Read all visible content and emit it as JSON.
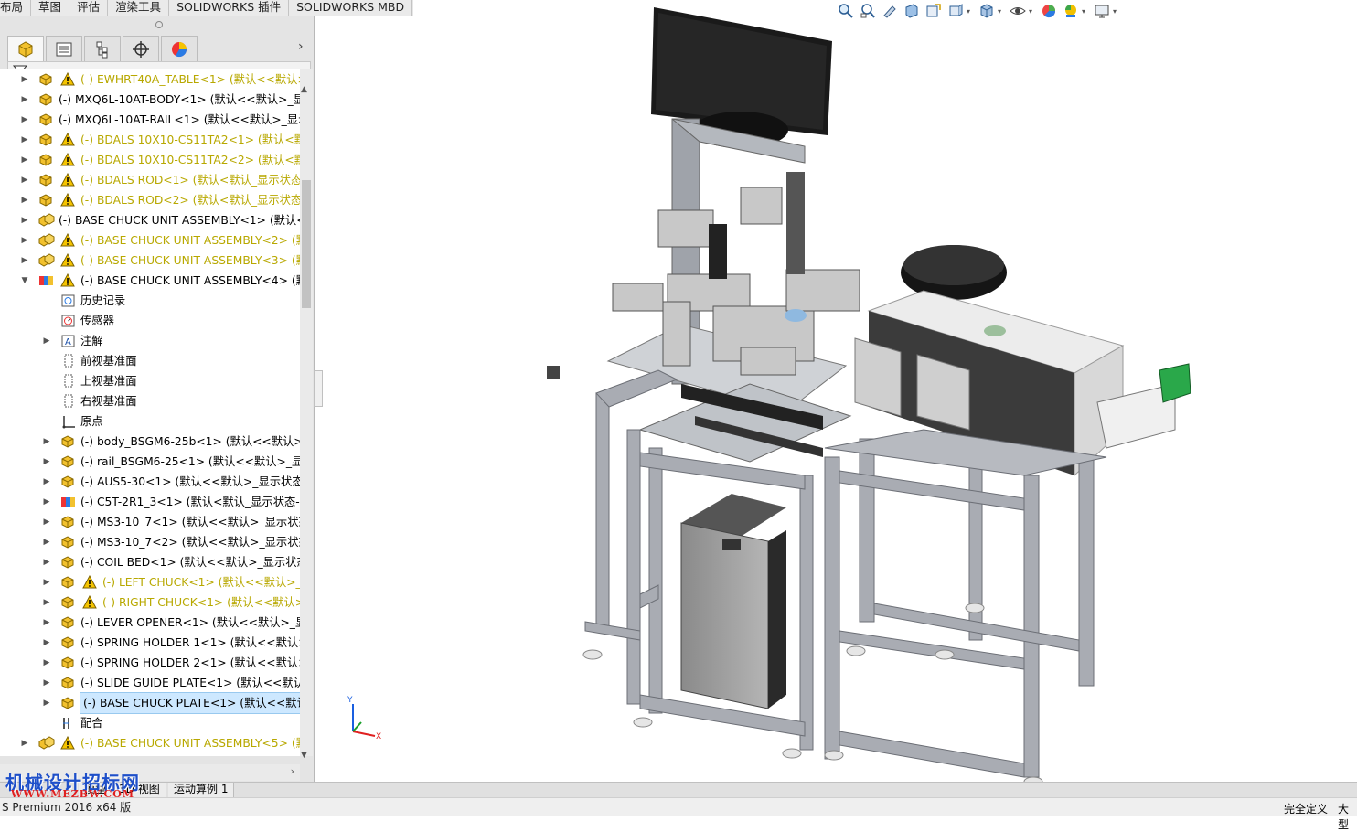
{
  "command_tabs": [
    "布局",
    "草图",
    "评估",
    "渲染工具",
    "SOLIDWORKS 插件",
    "SOLIDWORKS MBD"
  ],
  "panel_tabs": [
    "feature-manager",
    "property-manager",
    "configuration-manager",
    "dimxpert-manager",
    "display-manager"
  ],
  "tree": [
    {
      "label": "(-) EWHRT40A_TABLE<1> (默认<<默认>_",
      "warn": true,
      "yellow": true,
      "level": 0,
      "expand": "closed"
    },
    {
      "label": "(-) MXQ6L-10AT-BODY<1> (默认<<默认>_显示",
      "warn": false,
      "yellow": false,
      "level": 0,
      "expand": "closed"
    },
    {
      "label": "(-) MXQ6L-10AT-RAIL<1> (默认<<默认>_显示",
      "warn": false,
      "yellow": false,
      "level": 0,
      "expand": "closed"
    },
    {
      "label": "(-) BDALS 10X10-CS11TA2<1> (默认<默认",
      "warn": true,
      "yellow": true,
      "level": 0,
      "expand": "closed"
    },
    {
      "label": "(-) BDALS 10X10-CS11TA2<2> (默认<默认",
      "warn": true,
      "yellow": true,
      "level": 0,
      "expand": "closed"
    },
    {
      "label": "(-) BDALS ROD<1> (默认<默认_显示状态-",
      "warn": true,
      "yellow": true,
      "level": 0,
      "expand": "closed"
    },
    {
      "label": "(-) BDALS ROD<2> (默认<默认_显示状态-1",
      "warn": true,
      "yellow": true,
      "level": 0,
      "expand": "closed"
    },
    {
      "label": "(-) BASE CHUCK UNIT ASSEMBLY<1> (默认<显",
      "warn": false,
      "yellow": false,
      "level": 0,
      "expand": "closed"
    },
    {
      "label": "(-) BASE CHUCK UNIT ASSEMBLY<2> (默",
      "warn": true,
      "yellow": true,
      "level": 0,
      "expand": "closed"
    },
    {
      "label": "(-) BASE CHUCK UNIT ASSEMBLY<3> (默",
      "warn": true,
      "yellow": true,
      "level": 0,
      "expand": "closed"
    },
    {
      "label": "(-) BASE CHUCK UNIT ASSEMBLY<4> (默",
      "warn": true,
      "yellow": false,
      "level": 0,
      "expand": "open"
    },
    {
      "label": "历史记录",
      "warn": false,
      "yellow": false,
      "level": 1,
      "expand": "none",
      "icon": "history"
    },
    {
      "label": "传感器",
      "warn": false,
      "yellow": false,
      "level": 1,
      "expand": "none",
      "icon": "sensor"
    },
    {
      "label": "注解",
      "warn": false,
      "yellow": false,
      "level": 1,
      "expand": "closed",
      "icon": "annotation"
    },
    {
      "label": "前视基准面",
      "warn": false,
      "yellow": false,
      "level": 1,
      "expand": "none",
      "icon": "plane"
    },
    {
      "label": "上视基准面",
      "warn": false,
      "yellow": false,
      "level": 1,
      "expand": "none",
      "icon": "plane"
    },
    {
      "label": "右视基准面",
      "warn": false,
      "yellow": false,
      "level": 1,
      "expand": "none",
      "icon": "plane"
    },
    {
      "label": "原点",
      "warn": false,
      "yellow": false,
      "level": 1,
      "expand": "none",
      "icon": "origin"
    },
    {
      "label": "(-) body_BSGM6-25b<1> (默认<<默认>_显",
      "warn": false,
      "yellow": false,
      "level": 1,
      "expand": "closed",
      "icon": "part"
    },
    {
      "label": "(-) rail_BSGM6-25<1> (默认<<默认>_显示",
      "warn": false,
      "yellow": false,
      "level": 1,
      "expand": "closed",
      "icon": "part"
    },
    {
      "label": "(-) AUS5-30<1> (默认<<默认>_显示状态 1",
      "warn": false,
      "yellow": false,
      "level": 1,
      "expand": "closed",
      "icon": "part"
    },
    {
      "label": "(-) C5T-2R1_3<1> (默认<默认_显示状态-1>",
      "warn": false,
      "yellow": false,
      "level": 1,
      "expand": "closed",
      "icon": "assembly"
    },
    {
      "label": "(-) MS3-10_7<1> (默认<<默认>_显示状态",
      "warn": false,
      "yellow": false,
      "level": 1,
      "expand": "closed",
      "icon": "part"
    },
    {
      "label": "(-) MS3-10_7<2> (默认<<默认>_显示状态",
      "warn": false,
      "yellow": false,
      "level": 1,
      "expand": "closed",
      "icon": "part"
    },
    {
      "label": "(-) COIL BED<1> (默认<<默认>_显示状态",
      "warn": false,
      "yellow": false,
      "level": 1,
      "expand": "closed",
      "icon": "part"
    },
    {
      "label": "(-) LEFT CHUCK<1> (默认<<默认>_显",
      "warn": true,
      "yellow": true,
      "level": 1,
      "expand": "closed",
      "icon": "part"
    },
    {
      "label": "(-) RIGHT CHUCK<1> (默认<<默认>_",
      "warn": true,
      "yellow": true,
      "level": 1,
      "expand": "closed",
      "icon": "part"
    },
    {
      "label": "(-) LEVER OPENER<1> (默认<<默认>_显示",
      "warn": false,
      "yellow": false,
      "level": 1,
      "expand": "closed",
      "icon": "part"
    },
    {
      "label": "(-) SPRING HOLDER 1<1> (默认<<默认>_",
      "warn": false,
      "yellow": false,
      "level": 1,
      "expand": "closed",
      "icon": "part"
    },
    {
      "label": "(-) SPRING HOLDER 2<1> (默认<<默认>_",
      "warn": false,
      "yellow": false,
      "level": 1,
      "expand": "closed",
      "icon": "part"
    },
    {
      "label": "(-) SLIDE GUIDE PLATE<1> (默认<<默认",
      "warn": false,
      "yellow": false,
      "level": 1,
      "expand": "closed",
      "icon": "part"
    },
    {
      "label": "(-) BASE CHUCK PLATE<1> (默认<<默认>_",
      "warn": false,
      "yellow": false,
      "level": 1,
      "expand": "closed",
      "icon": "part",
      "selected": true
    },
    {
      "label": "配合",
      "warn": false,
      "yellow": false,
      "level": 1,
      "expand": "none",
      "icon": "mates"
    },
    {
      "label": "(-) BASE CHUCK UNIT ASSEMBLY<5> (默",
      "warn": true,
      "yellow": true,
      "level": 0,
      "expand": "closed"
    }
  ],
  "bottom_tabs": [
    "模型",
    "3D 视图",
    "运动算例 1"
  ],
  "status": {
    "version": "S Premium 2016 x64 版",
    "defined": "完全定义",
    "size": "大型"
  },
  "watermark": {
    "line1": "机械设计招标网",
    "line2": "WWW.MEZBW.COM"
  },
  "hud_icons": [
    "zoom-to-fit-icon",
    "zoom-area-icon",
    "previous-view-icon",
    "section-view-icon",
    "dynamic-annotation-icon",
    "view-orientation-icon",
    "display-style-icon",
    "hide-show-icon",
    "edit-appearance-icon",
    "apply-scene-icon",
    "view-settings-icon"
  ],
  "colors": {
    "warning": "#f5c400",
    "yellow_text": "#b8a800",
    "selection": "#cde8ff",
    "frame": "#a9acb3"
  }
}
